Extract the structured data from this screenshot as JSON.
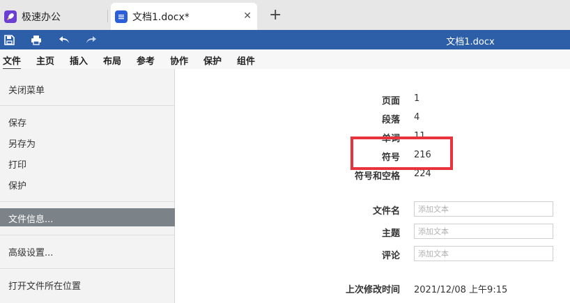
{
  "tabs": [
    {
      "label": "极速办公",
      "icon": "rocket-icon"
    },
    {
      "label": "文档1.docx*",
      "icon": "document-icon"
    }
  ],
  "toolbar": {
    "title": "文档1.docx",
    "buttons": [
      "save-icon",
      "print-icon",
      "undo-icon",
      "redo-icon"
    ]
  },
  "menu": [
    "文件",
    "主页",
    "插入",
    "布局",
    "参考",
    "协作",
    "保护",
    "组件"
  ],
  "left_menu": {
    "close": "关闭菜单",
    "save": "保存",
    "save_as": "另存为",
    "print": "打印",
    "protect": "保护",
    "file_info": "文件信息...",
    "advanced": "高级设置...",
    "open_location": "打开文件所在位置"
  },
  "stats": [
    {
      "label": "页面",
      "value": "1"
    },
    {
      "label": "段落",
      "value": "4"
    },
    {
      "label": "单词",
      "value": "11"
    },
    {
      "label": "符号",
      "value": "216"
    },
    {
      "label": "符号和空格",
      "value": "224"
    }
  ],
  "fields": [
    {
      "label": "文件名",
      "placeholder": "添加文本"
    },
    {
      "label": "主题",
      "placeholder": "添加文本"
    },
    {
      "label": "评论",
      "placeholder": "添加文本"
    }
  ],
  "last_modified": {
    "label": "上次修改时间",
    "value": "2021/12/08 上午9:15"
  },
  "colors": {
    "accent": "#2d5fa8",
    "highlight": "#e8323c",
    "selected": "#7c8388"
  }
}
